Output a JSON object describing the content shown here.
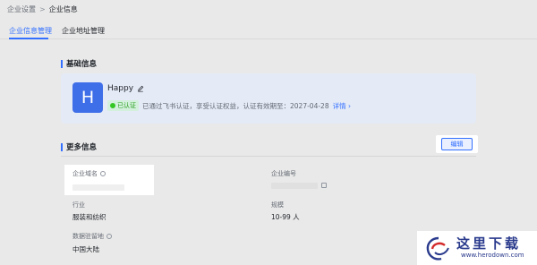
{
  "breadcrumb": {
    "parent": "企业设置",
    "separator": ">",
    "current": "企业信息"
  },
  "tabs": [
    {
      "label": "企业信息管理",
      "active": true
    },
    {
      "label": "企业地址管理",
      "active": false
    }
  ],
  "basic": {
    "title": "基础信息",
    "avatar_letter": "H",
    "company_name": "Happy",
    "cert_badge": "已认证",
    "cert_text": "已通过飞书认证，享受认证权益，认证有效期至：2027-04-28",
    "cert_link": "详情"
  },
  "more": {
    "title": "更多信息",
    "edit_label": "编辑",
    "fields": {
      "domain_label": "企业域名",
      "code_label": "企业编号",
      "industry_label": "行业",
      "industry_value": "服装和纺织",
      "scale_label": "规模",
      "scale_value": "10-99 人",
      "storage_label": "数据驻留地",
      "storage_value": "中国大陆"
    }
  },
  "watermark": {
    "title": "这里下载",
    "url": "www.herodown.com"
  },
  "colors": {
    "accent": "#3370ff",
    "avatar": "#3e6ee8",
    "cert_green": "#2ea121"
  }
}
